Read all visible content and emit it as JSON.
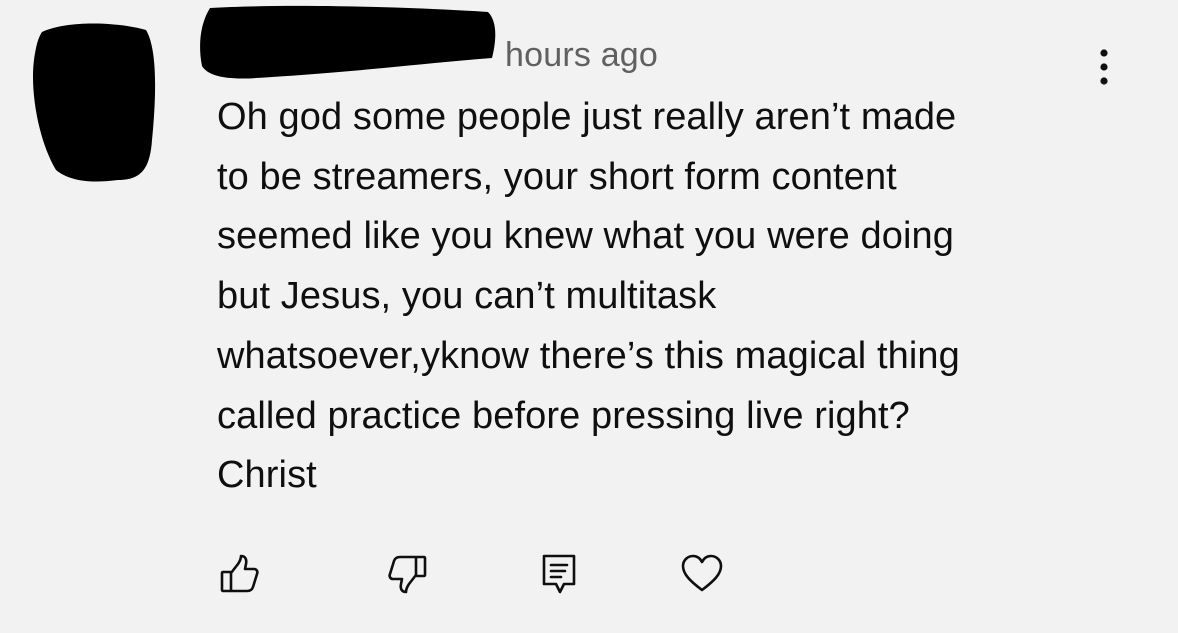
{
  "comment": {
    "timestamp": "hours ago",
    "text_lines": [
      "Oh god some people just really aren’t made",
      "to be streamers, your short form content",
      "seemed like you knew what you were doing",
      "but Jesus, you can’t multitask",
      "whatsoever,yknow there’s this magical thing",
      "called practice before pressing live right?",
      "Christ"
    ],
    "avatar": "redacted-avatar",
    "username": "redacted-username"
  },
  "actions": {
    "like_icon": "thumbs-up-icon",
    "dislike_icon": "thumbs-down-icon",
    "reply_icon": "reply-comment-icon",
    "heart_icon": "heart-icon",
    "more_icon": "vertical-dots-icon"
  },
  "colors": {
    "background": "#f2f2f2",
    "text": "#0f0f0f",
    "secondary_text": "#606060",
    "redaction": "#000000"
  }
}
